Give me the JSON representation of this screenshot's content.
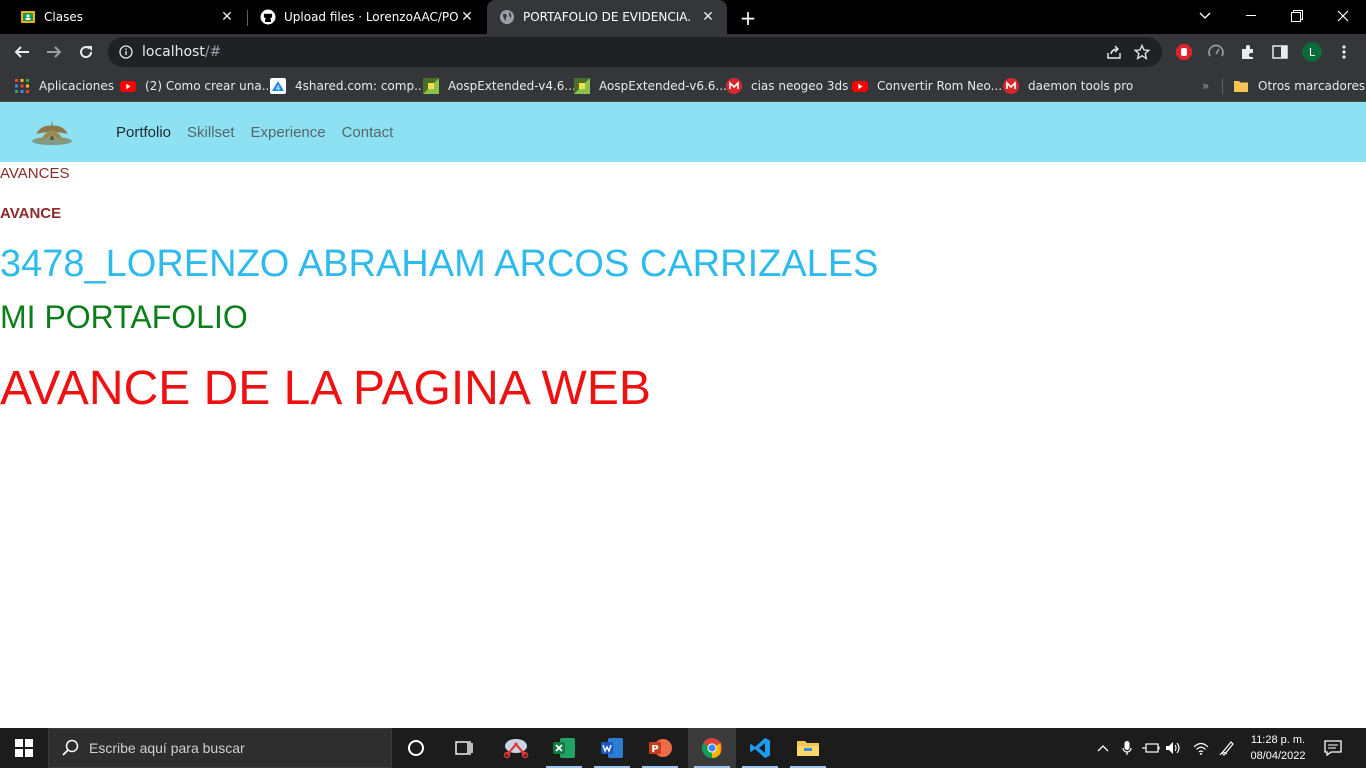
{
  "browser": {
    "tabs": [
      {
        "title": "Clases",
        "active": false
      },
      {
        "title": "Upload files · LorenzoAAC/PORTA",
        "active": false
      },
      {
        "title": "PORTAFOLIO DE EVIDENCIA.",
        "active": true
      }
    ],
    "address": {
      "host": "localhost",
      "path": "/#"
    },
    "bookmarks": [
      {
        "label": "Aplicaciones",
        "icon": "apps-grid-icon"
      },
      {
        "label": "(2) Como crear una...",
        "icon": "youtube-icon"
      },
      {
        "label": "4shared.com: comp...",
        "icon": "4shared-icon"
      },
      {
        "label": "AospExtended-v4.6...",
        "icon": "aosp-icon"
      },
      {
        "label": "AospExtended-v6.6...",
        "icon": "aosp-icon"
      },
      {
        "label": "cias neogeo 3ds",
        "icon": "mega-icon"
      },
      {
        "label": "Convertir Rom Neo...",
        "icon": "youtube-icon"
      },
      {
        "label": "daemon tools pro",
        "icon": "mega-icon"
      }
    ],
    "other_bookmarks": "Otros marcadores",
    "profile_initial": "L",
    "overflow_chevron": "»"
  },
  "page": {
    "nav": {
      "links": [
        "Portfolio",
        "Skillset",
        "Experience",
        "Contact"
      ],
      "active": "Portfolio"
    },
    "avances_label": "AVANCES",
    "avance_heading": "AVANCE",
    "student_name": "3478_LORENZO ABRAHAM ARCOS CARRIZALES",
    "portfolio_title": "MI PORTAFOLIO",
    "progress_title": "AVANCE DE LA PAGINA WEB"
  },
  "taskbar": {
    "search_placeholder": "Escribe aquí para buscar",
    "apps": [
      "task-view",
      "snipping-tool",
      "excel",
      "word",
      "powerpoint",
      "chrome",
      "vscode",
      "file-explorer"
    ],
    "active_app": "chrome",
    "time": "11:28 p. m.",
    "date": "08/04/2022"
  },
  "colors": {
    "navbar_bg": "#8ee1f2",
    "avances": "#8b2b2b",
    "name": "#2ebbec",
    "portfolio": "#0b7e1a",
    "progress": "#ee1111"
  }
}
